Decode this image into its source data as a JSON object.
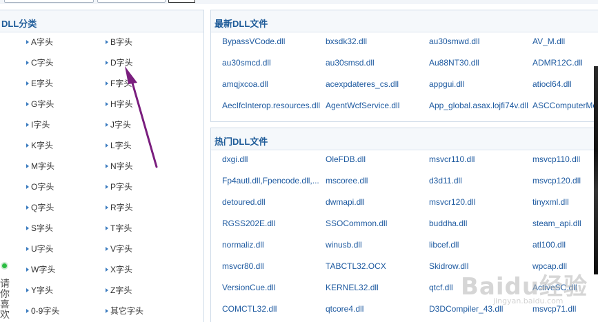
{
  "sidebar": {
    "title": "DLL分类",
    "letters": [
      "A字头",
      "B字头",
      "C字头",
      "D字头",
      "E字头",
      "F字头",
      "G字头",
      "H字头",
      "I字头",
      "J字头",
      "K字头",
      "L字头",
      "M字头",
      "N字头",
      "O字头",
      "P字头",
      "Q字头",
      "R字头",
      "S字头",
      "T字头",
      "U字头",
      "V字头",
      "W字头",
      "X字头",
      "Y字头",
      "Z字头",
      "0-9字头",
      "其它字头"
    ],
    "side_widget_text": "请你喜欢"
  },
  "latest": {
    "title": "最新DLL文件",
    "files": [
      "BypassVCode.dll",
      "bxsdk32.dll",
      "au30smwd.dll",
      "AV_M.dll",
      "au30smcd.dll",
      "au30smsd.dll",
      "Au88NT30.dll",
      "ADMR12C.dll",
      "amqjxcoa.dll",
      "acexpdateres_cs.dll",
      "appgui.dll",
      "atiocl64.dll",
      "AecIfcInterop.resources.dll",
      "AgentWcfService.dll",
      "App_global.asax.lojfi74v.dll",
      "ASCComputerMe"
    ]
  },
  "popular": {
    "title": "热门DLL文件",
    "files": [
      "dxgi.dll",
      "OleFDB.dll",
      "msvcr110.dll",
      "msvcp110.dll",
      "Fp4autl.dll,Fpencode.dll,...",
      "mscoree.dll",
      "d3d11.dll",
      "msvcp120.dll",
      "detoured.dll",
      "dwmapi.dll",
      "msvcr120.dll",
      "tinyxml.dll",
      "RGSS202E.dll",
      "SSOCommon.dll",
      "buddha.dll",
      "steam_api.dll",
      "normaliz.dll",
      "winusb.dll",
      "libcef.dll",
      "atl100.dll",
      "msvcr80.dll",
      "TABCTL32.OCX",
      "Skidrow.dll",
      "wpcap.dll",
      "VersionCue.dll",
      "KERNEL32.dll",
      "qtcf.dll",
      "ActiveSC.dll",
      "COMCTL32.dll",
      "qtcore4.dll",
      "D3DCompiler_43.dll",
      "msvcp71.dll"
    ]
  },
  "watermark": {
    "main": "Baidu经验",
    "sub": "jingyan.baidu.com"
  },
  "colors": {
    "link": "#1e5aa0",
    "title": "#1f5c99",
    "arrow": "#7a1e7e",
    "online_dot": "#2bbd42"
  }
}
